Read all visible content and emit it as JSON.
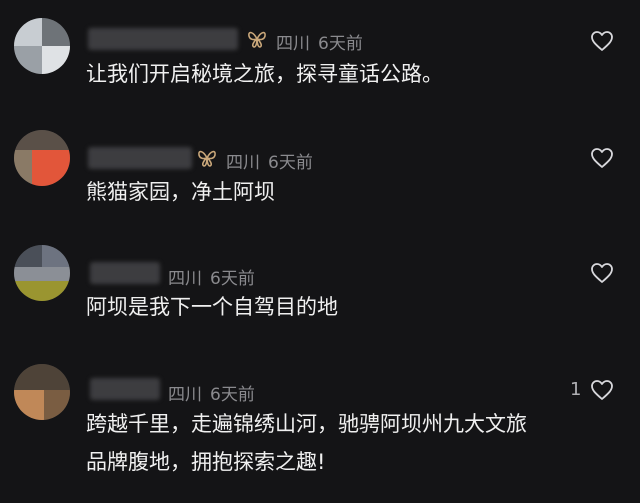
{
  "comments": [
    {
      "location": "四川",
      "time": "6天前",
      "text": "让我们开启秘境之旅，探寻童话公路。",
      "likes": "",
      "badge": "butterfly-icon"
    },
    {
      "location": "四川",
      "time": "6天前",
      "text": "熊猫家园，净土阿坝",
      "likes": "",
      "badge": "butterfly-icon"
    },
    {
      "location": "四川",
      "time": "6天前",
      "text": "阿坝是我下一个自驾目的地",
      "likes": "",
      "badge": ""
    },
    {
      "location": "四川",
      "time": "6天前",
      "text_line1": "跨越千里，走遍锦绣山河，驰骋阿坝州九大文旅",
      "text_line2": "品牌腹地，拥抱探索之趣!",
      "likes": "1",
      "badge": ""
    }
  ],
  "colors": {
    "background": "#141416",
    "text": "#f0f0f0",
    "meta": "#8a8a8e",
    "badge": "#c9a77a"
  }
}
